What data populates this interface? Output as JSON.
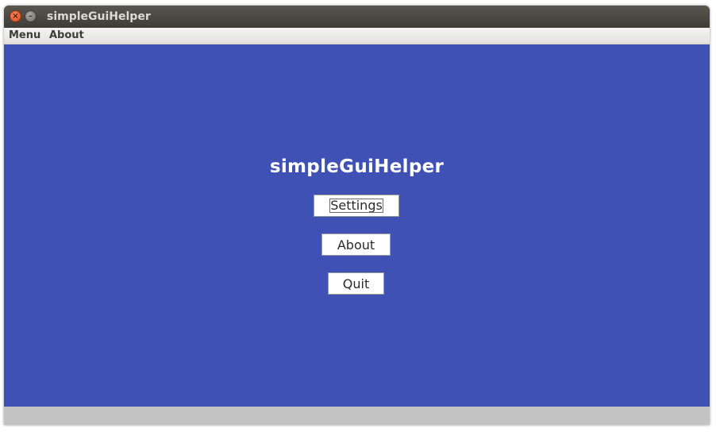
{
  "window": {
    "title": "simpleGuiHelper",
    "close_symbol": "×",
    "minimize_symbol": "–"
  },
  "menubar": {
    "items": [
      "Menu",
      "About"
    ]
  },
  "main": {
    "title": "simpleGuiHelper",
    "buttons": {
      "settings": "Settings",
      "about": "About",
      "quit": "Quit"
    }
  },
  "colors": {
    "content_background": "#3f51b5",
    "title_text": "#ffffff",
    "button_background": "#ffffff",
    "statusbar": "#c3c3c3"
  },
  "icons": {
    "close": "close-icon",
    "minimize": "minimize-icon"
  }
}
